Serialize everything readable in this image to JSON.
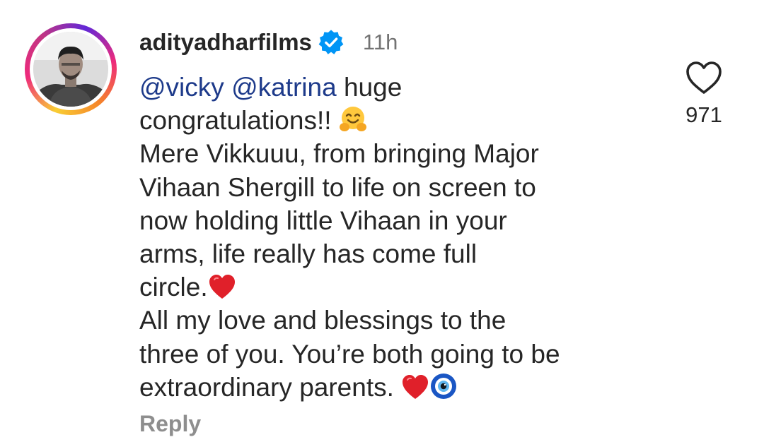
{
  "comment": {
    "username": "adityadharfilms",
    "verified": true,
    "time": "11h",
    "mention_1": "@vicky",
    "mention_2": "@katrina",
    "line_1_rest": " huge",
    "line_2": "congratulations!! ",
    "line_3": "Mere Vikkuuu, from bringing Major",
    "line_4": "Vihaan Shergill to life on screen to",
    "line_5": "now holding little Vihaan in your",
    "line_6": "arms, life really has come full",
    "line_7": "circle.",
    "line_8": "All my love and blessings to the",
    "line_9": "three of you. You’re both going to be",
    "line_10": "extraordinary parents. ",
    "emojis": [
      "hugging-face-emoji",
      "red-heart-emoji",
      "red-heart-emoji",
      "nazar-amulet-emoji"
    ],
    "like_count": "971",
    "reply_label": "Reply"
  },
  "colors": {
    "mention": "#1d3a8a",
    "verified_badge": "#0095f6",
    "timestamp": "#737373",
    "reply": "#8e8e8e",
    "heart": "#e0202a"
  },
  "icons": {
    "like": "heart-outline-icon",
    "verified": "verified-badge-icon"
  }
}
